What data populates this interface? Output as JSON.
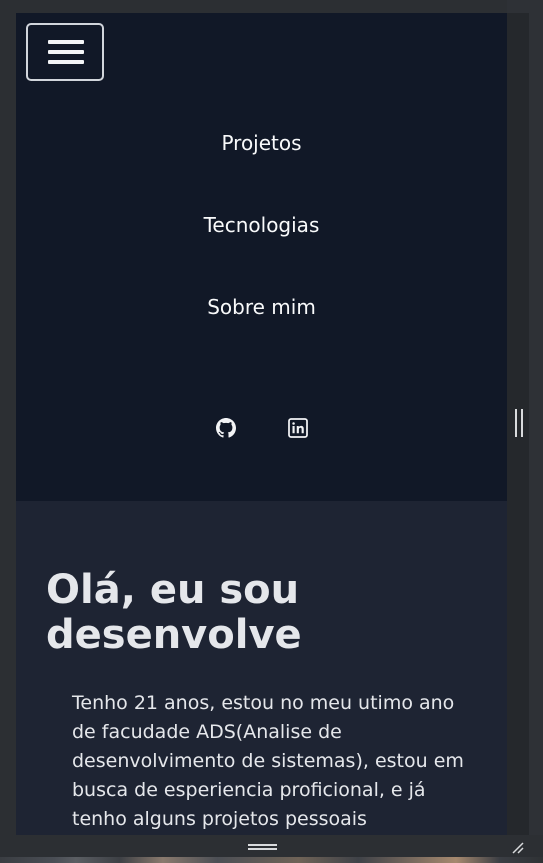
{
  "nav": {
    "menu_button_icon": "hamburger-menu-icon",
    "links": [
      {
        "label": "Projetos"
      },
      {
        "label": "Tecnologias"
      },
      {
        "label": "Sobre mim"
      }
    ],
    "social": [
      {
        "icon": "github-icon"
      },
      {
        "icon": "linkedin-icon"
      }
    ]
  },
  "hero": {
    "title": "Olá, eu sou desenvolve",
    "text": "Tenho 21 anos, estou no meu utimo ano de facudade ADS(Analise de desenvolvimento de sistemas), estou em busca de esperiencia proficional, e já tenho alguns projetos pessoais"
  },
  "colors": {
    "nav_bg": "#111827",
    "hero_bg": "#1e2433",
    "text": "#e5e7eb"
  }
}
